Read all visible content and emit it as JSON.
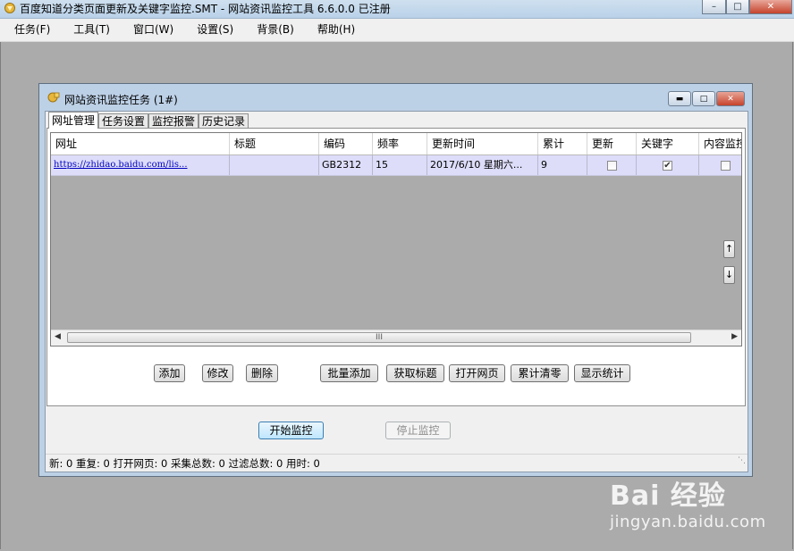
{
  "app": {
    "title": "百度知道分类页面更新及关键字监控.SMT  - 网站资讯监控工具 6.6.0.0 已注册"
  },
  "menu": [
    {
      "label": "任务(F)"
    },
    {
      "label": "工具(T)"
    },
    {
      "label": "窗口(W)"
    },
    {
      "label": "设置(S)"
    },
    {
      "label": "背景(B)"
    },
    {
      "label": "帮助(H)"
    }
  ],
  "child_window": {
    "title": "网站资讯监控任务  (1#)",
    "tabs": [
      {
        "label": "网址管理",
        "active": true
      },
      {
        "label": "任务设置",
        "active": false
      },
      {
        "label": "监控报警",
        "active": false
      },
      {
        "label": "历史记录",
        "active": false
      }
    ],
    "grid": {
      "columns": [
        "网址",
        "标题",
        "编码",
        "频率",
        "更新时间",
        "累计",
        "更新",
        "关键字",
        "内容监控"
      ],
      "rows": [
        {
          "url": "https://zhidao.baidu.com/lis...",
          "title": "",
          "encoding": "GB2312",
          "frequency": "15",
          "update_time": "2017/6/10  星期六...",
          "total": "9",
          "update_checked": false,
          "keyword_checked": true,
          "content_checked": false
        }
      ],
      "scroll_grip": "III",
      "up_arrow": "↑",
      "down_arrow": "↓"
    },
    "buttons": {
      "add": "添加",
      "edit": "修改",
      "delete": "删除",
      "batch_add": "批量添加",
      "get_title": "获取标题",
      "open_page": "打开网页",
      "reset_total": "累计清零",
      "show_stats": "显示统计",
      "start": "开始监控",
      "stop": "停止监控"
    },
    "status": "新:  0  重复:  0  打开网页:  0  采集总数:  0  过滤总数:  0  用时:  0"
  },
  "watermark": {
    "logo": "Bai 经验",
    "url": "jingyan.baidu.com"
  },
  "colors": {
    "selected_row": "#ddddfa",
    "link": "#0000c0",
    "mdi_background": "#ababab"
  }
}
